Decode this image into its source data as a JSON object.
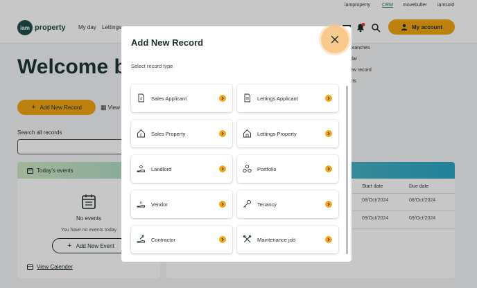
{
  "top_links": [
    "iamproperty",
    "CRM",
    "movebutler",
    "iamsold"
  ],
  "header": {
    "logo_mark": "iam",
    "logo_text": "property",
    "nav": [
      "My day",
      "Lettings"
    ],
    "account_label": "My account",
    "notification_count": "1"
  },
  "page": {
    "welcome_title": "Welcome ba",
    "add_record_label": "Add New Record",
    "view_label": "View",
    "search_label": "Search all records",
    "side_links": [
      "branches",
      "dar",
      "ew record",
      "cts"
    ]
  },
  "events": {
    "title": "Today's events",
    "empty_title": "No events",
    "empty_sub": "You have no events today",
    "add_event_label": "Add New Event",
    "view_calendar_label": "View Calender"
  },
  "tasks": {
    "columns": [
      "Start date",
      "Due date"
    ],
    "rows": [
      [
        "08/Oct/2024",
        "08/Oct/2024"
      ],
      [
        "09/Oct/2024",
        "09/Oct/2024"
      ]
    ]
  },
  "modal": {
    "title": "Add New Record",
    "subtitle": "Select record type",
    "record_types": [
      {
        "label": "Sales Applicant",
        "icon": "document-pound-icon"
      },
      {
        "label": "Lettings Applicant",
        "icon": "document-icon"
      },
      {
        "label": "Sales Property",
        "icon": "house-pound-icon"
      },
      {
        "label": "Lettings Property",
        "icon": "house-icon"
      },
      {
        "label": "Landlord",
        "icon": "hand-key-icon"
      },
      {
        "label": "Portfolio",
        "icon": "cluster-icon"
      },
      {
        "label": "Vendor",
        "icon": "hand-money-icon"
      },
      {
        "label": "Tenancy",
        "icon": "key-icon"
      },
      {
        "label": "Contractor",
        "icon": "hand-wrench-icon"
      },
      {
        "label": "Maintenance job",
        "icon": "tools-icon"
      }
    ]
  },
  "colors": {
    "accent": "#f3a712",
    "brand_dark": "#1d3432",
    "close_halo": "#f8c98c"
  }
}
